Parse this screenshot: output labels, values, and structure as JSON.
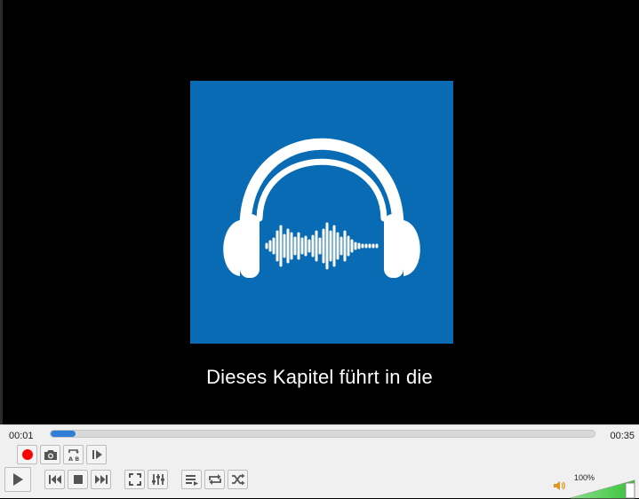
{
  "player": {
    "subtitle": "Dieses Kapitel führt in die",
    "time_elapsed": "00:01",
    "time_total": "00:35",
    "progress_fraction": 0.045,
    "volume_label": "100%",
    "volume_fraction": 1.0,
    "record_color": "#ff0000",
    "accent_color": "#2f7fd6",
    "art_bg_color": "#0a6bb5",
    "volume_color": "#36c236"
  },
  "icons": {
    "record": "record-icon",
    "snapshot": "camera-icon",
    "loop_ab": "ab-loop-icon",
    "frame_step": "frame-step-icon",
    "play": "play-icon",
    "previous": "skip-previous-icon",
    "stop": "stop-icon",
    "next": "skip-next-icon",
    "fullscreen": "fullscreen-icon",
    "extended_settings": "equalizer-icon",
    "playlist": "playlist-icon",
    "loop": "loop-icon",
    "shuffle": "shuffle-icon",
    "volume": "speaker-icon",
    "album_art": "headphones-icon"
  }
}
